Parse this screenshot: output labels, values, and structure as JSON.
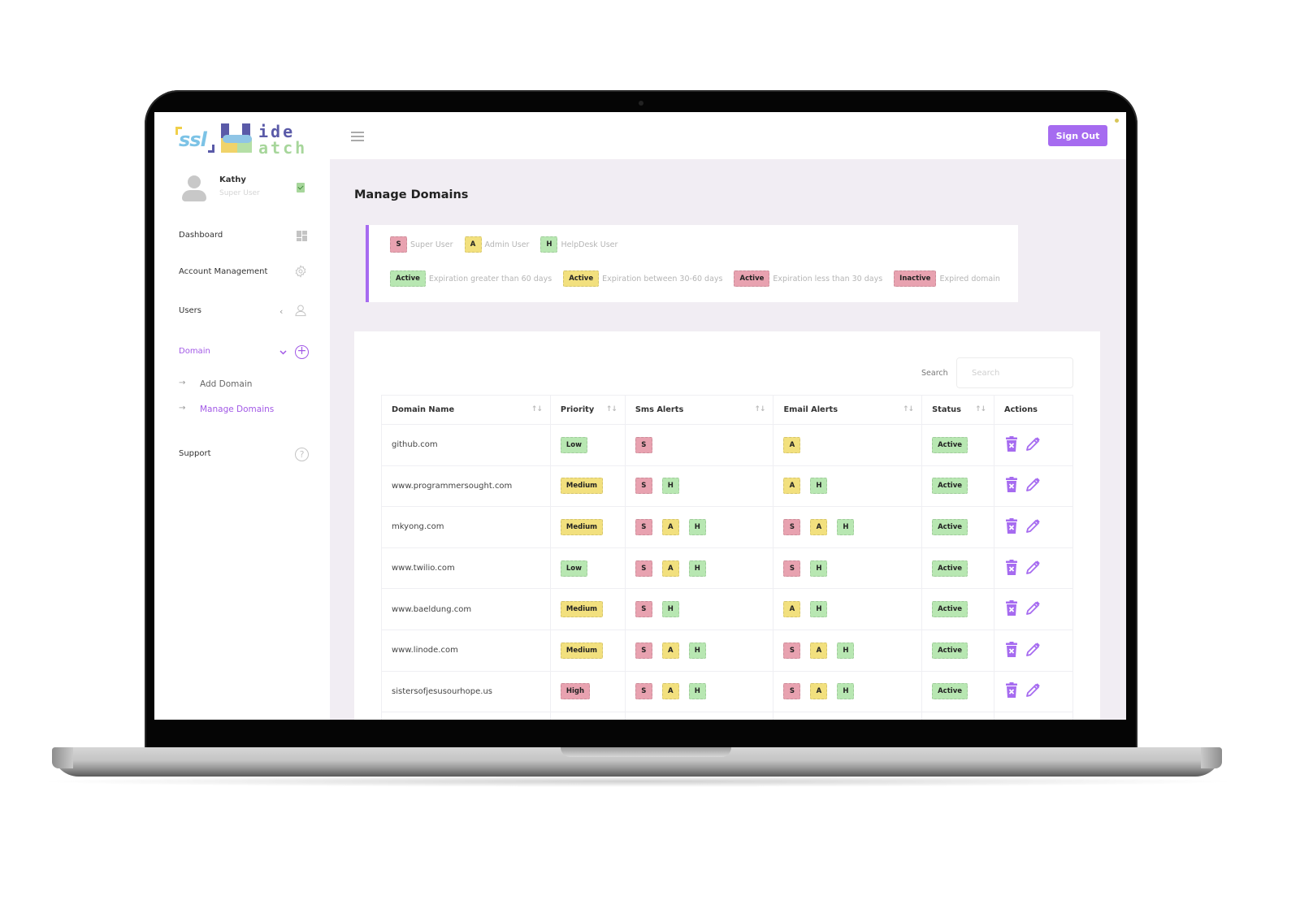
{
  "app": {
    "logo_text_left": "ssl",
    "logo_text_top": "ide",
    "logo_text_bottom": "atch"
  },
  "user": {
    "name": "Kathy",
    "role": "Super User"
  },
  "sidebar": {
    "items": [
      {
        "label": "Dashboard",
        "icon": "dashboard-grid-icon"
      },
      {
        "label": "Account Management",
        "icon": "gear-icon"
      },
      {
        "label": "Users",
        "icon": "user-icon",
        "chevron": "‹"
      },
      {
        "label": "Domain",
        "icon": "plus-circle-icon",
        "chevron": "⌄",
        "active": true
      },
      {
        "label": "Support",
        "icon": "question-circle-icon"
      }
    ],
    "domain_subitems": [
      {
        "arrow": "→",
        "label": "Add Domain"
      },
      {
        "arrow": "→",
        "label": "Manage Domains",
        "active": true
      }
    ]
  },
  "topbar": {
    "menu_icon": "hamburger-icon",
    "signout_label": "Sign Out"
  },
  "page": {
    "title": "Manage Domains"
  },
  "legend": {
    "roles": [
      {
        "code": "S",
        "label": "Super User",
        "color": "#e8a2b0"
      },
      {
        "code": "A",
        "label": "Admin User",
        "color": "#f2e07e"
      },
      {
        "code": "H",
        "label": "HelpDesk User",
        "color": "#b8e7b2"
      }
    ],
    "statuses": [
      {
        "badge": "Active",
        "label": "Expiration greater than 60 days",
        "color": "#b8e7b2"
      },
      {
        "badge": "Active",
        "label": "Expiration between 30-60 days",
        "color": "#f2e07e"
      },
      {
        "badge": "Active",
        "label": "Expiration less than 30 days",
        "color": "#e8a2b0"
      },
      {
        "badge": "Inactive",
        "label": "Expired domain",
        "color": "#e8a2b0"
      }
    ]
  },
  "search": {
    "label": "Search",
    "placeholder": "Search",
    "value": ""
  },
  "table": {
    "sort_icon": "↑↓",
    "columns": [
      "Domain Name",
      "Priority",
      "Sms Alerts",
      "Email Alerts",
      "Status",
      "Actions"
    ],
    "rows": [
      {
        "domain": "github.com",
        "priority": "Low",
        "sms": [
          "S"
        ],
        "email": [
          "A"
        ],
        "status": "Active"
      },
      {
        "domain": "www.programmersought.com",
        "priority": "Medium",
        "sms": [
          "S",
          "H"
        ],
        "email": [
          "A",
          "H"
        ],
        "status": "Active"
      },
      {
        "domain": "mkyong.com",
        "priority": "Medium",
        "sms": [
          "S",
          "A",
          "H"
        ],
        "email": [
          "S",
          "A",
          "H"
        ],
        "status": "Active"
      },
      {
        "domain": "www.twilio.com",
        "priority": "Low",
        "sms": [
          "S",
          "A",
          "H"
        ],
        "email": [
          "S",
          "H"
        ],
        "status": "Active"
      },
      {
        "domain": "www.baeldung.com",
        "priority": "Medium",
        "sms": [
          "S",
          "H"
        ],
        "email": [
          "A",
          "H"
        ],
        "status": "Active"
      },
      {
        "domain": "www.linode.com",
        "priority": "Medium",
        "sms": [
          "S",
          "A",
          "H"
        ],
        "email": [
          "S",
          "A",
          "H"
        ],
        "status": "Active"
      },
      {
        "domain": "sistersofjesusourhope.us",
        "priority": "High",
        "sms": [
          "S",
          "A",
          "H"
        ],
        "email": [
          "S",
          "A",
          "H"
        ],
        "status": "Active"
      }
    ]
  },
  "colors": {
    "accent": "#a66bf0",
    "super_user": "#e8a2b0",
    "admin_user": "#f2e07e",
    "helpdesk_user": "#b8e7b2",
    "priority_low": "#b8e7b2",
    "priority_medium": "#f2e07e",
    "priority_high": "#e8a2b0",
    "status_active": "#b8e7b2",
    "main_bg": "#f1edf3"
  }
}
